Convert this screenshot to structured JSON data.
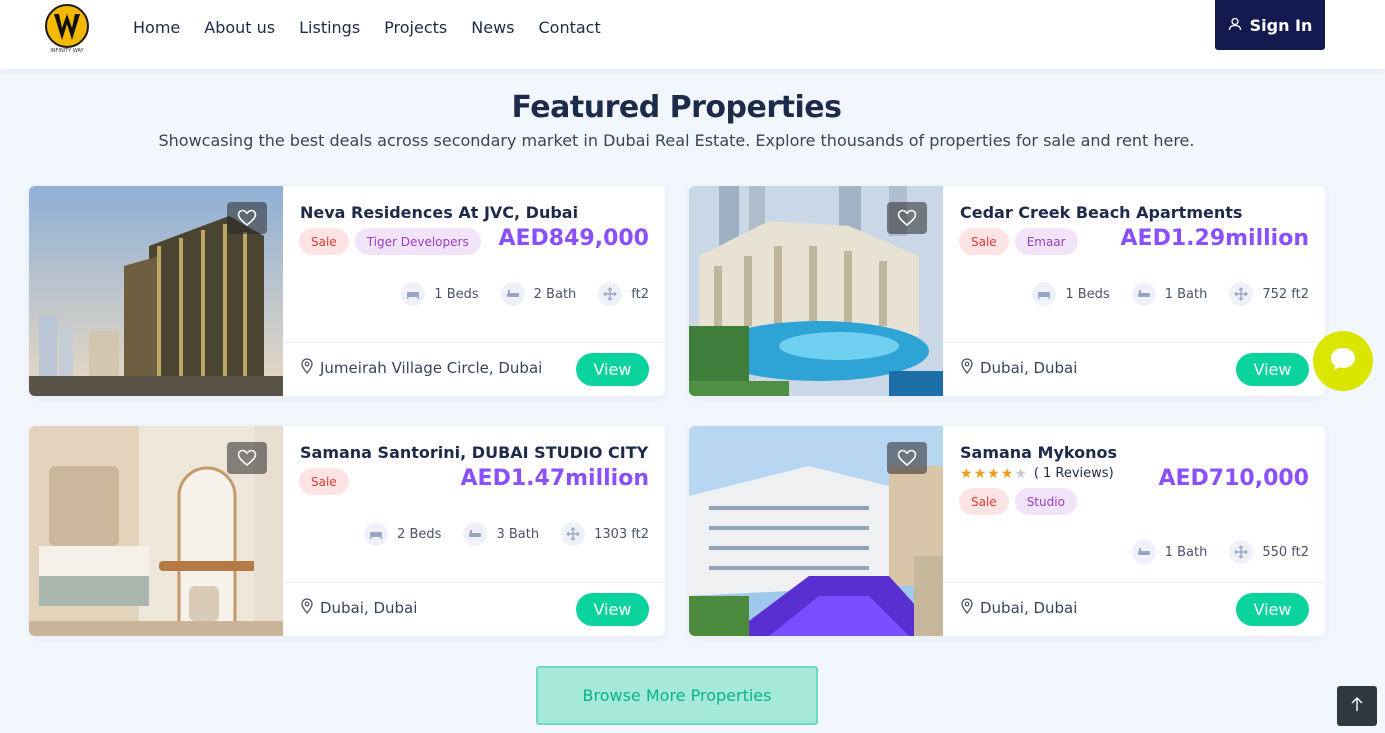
{
  "header": {
    "logo_text": "INFINITY WAY",
    "nav": [
      {
        "label": "Home"
      },
      {
        "label": "About us"
      },
      {
        "label": "Listings"
      },
      {
        "label": "Projects"
      },
      {
        "label": "News"
      },
      {
        "label": "Contact"
      }
    ],
    "signin_label": "Sign In"
  },
  "section": {
    "title": "Featured Properties",
    "subtitle": "Showcasing the best deals across secondary market in Dubai Real Estate. Explore thousands of properties for sale and rent here."
  },
  "listings": [
    {
      "title": "Neva Residences At JVC, Dubai",
      "tags": [
        "Sale",
        "Tiger Developers"
      ],
      "price": "AED849,000",
      "beds": "1 Beds",
      "bath": "2 Bath",
      "area": "ft2",
      "location": "Jumeirah Village Circle, Dubai",
      "view_label": "View"
    },
    {
      "title": "Cedar Creek Beach Apartments",
      "tags": [
        "Sale",
        "Emaar"
      ],
      "price": "AED1.29million",
      "beds": "1 Beds",
      "bath": "1 Bath",
      "area": "752 ft2",
      "location": "Dubai, Dubai",
      "view_label": "View"
    },
    {
      "title": "Samana Santorini, DUBAI STUDIO CITY",
      "tags": [
        "Sale"
      ],
      "price": "AED1.47million",
      "beds": "2 Beds",
      "bath": "3 Bath",
      "area": "1303 ft2",
      "location": "Dubai, Dubai",
      "view_label": "View"
    },
    {
      "title": "Samana Mykonos",
      "rating": 4,
      "reviews": "( 1 Reviews)",
      "tags": [
        "Sale",
        "Studio"
      ],
      "price": "AED710,000",
      "bath": "1 Bath",
      "area": "550 ft2",
      "location": "Dubai, Dubai",
      "view_label": "View"
    }
  ],
  "browse_label": "Browse More Properties",
  "colors": {
    "accent_green": "#0bd39d",
    "price_purple": "#8a4fff",
    "navy": "#141a4f",
    "chat_yellow": "#dbe600"
  }
}
